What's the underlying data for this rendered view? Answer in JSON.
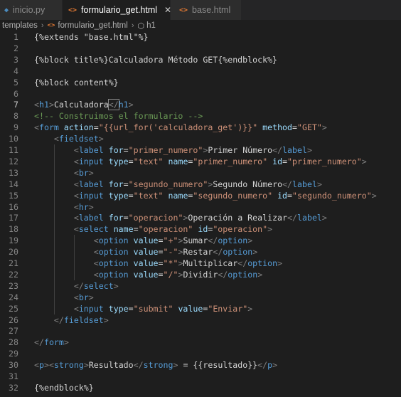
{
  "tabs": [
    {
      "icon": "python-file-icon",
      "glyph": "◆",
      "label": "inicio.py",
      "active": false,
      "color": "#4b8bbe"
    },
    {
      "icon": "html-file-icon",
      "glyph": "<>",
      "label": "formulario_get.html",
      "active": true,
      "color": "#e37933"
    },
    {
      "icon": "html-file-icon",
      "glyph": "<>",
      "label": "base.html",
      "active": false,
      "color": "#e37933"
    }
  ],
  "close_glyph": "✕",
  "breadcrumb": {
    "folder": "templates",
    "file": "formulario_get.html",
    "symbol": "h1"
  },
  "current_line": 7,
  "lines": [
    {
      "n": "1",
      "t": [
        [
          "tx",
          "{%extends \"base.html\"%}"
        ]
      ]
    },
    {
      "n": "2",
      "t": []
    },
    {
      "n": "3",
      "t": [
        [
          "tx",
          "{%block title%}Calculadora Método GET{%endblock%}"
        ]
      ]
    },
    {
      "n": "4",
      "t": []
    },
    {
      "n": "5",
      "t": [
        [
          "tx",
          "{%block content%}"
        ]
      ]
    },
    {
      "n": "6",
      "t": []
    },
    {
      "n": "7",
      "t": [
        [
          "t",
          "<"
        ],
        [
          "tag",
          "h1"
        ],
        [
          "t",
          ">"
        ],
        [
          "tx",
          "Calculadora"
        ],
        [
          "t",
          "</"
        ],
        [
          "tag",
          "h1"
        ],
        [
          "t",
          ">"
        ]
      ]
    },
    {
      "n": "8",
      "t": [
        [
          "cm",
          "<!-- Construimos el formulario -->"
        ]
      ]
    },
    {
      "n": "9",
      "t": [
        [
          "t",
          "<"
        ],
        [
          "tag",
          "form"
        ],
        [
          "tx",
          " "
        ],
        [
          "at",
          "action"
        ],
        [
          "tx",
          "="
        ],
        [
          "st",
          "\"{{url_for('calculadora_get')}}\""
        ],
        [
          "tx",
          " "
        ],
        [
          "at",
          "method"
        ],
        [
          "tx",
          "="
        ],
        [
          "st",
          "\"GET\""
        ],
        [
          "t",
          ">"
        ]
      ]
    },
    {
      "n": "10",
      "t": [
        [
          "tx",
          "    "
        ],
        [
          "t",
          "<"
        ],
        [
          "tag",
          "fieldset"
        ],
        [
          "t",
          ">"
        ]
      ]
    },
    {
      "n": "11",
      "t": [
        [
          "tx",
          "        "
        ],
        [
          "t",
          "<"
        ],
        [
          "tag",
          "label"
        ],
        [
          "tx",
          " "
        ],
        [
          "at",
          "for"
        ],
        [
          "tx",
          "="
        ],
        [
          "st",
          "\"primer_numero\""
        ],
        [
          "t",
          ">"
        ],
        [
          "tx",
          "Primer Número"
        ],
        [
          "t",
          "</"
        ],
        [
          "tag",
          "label"
        ],
        [
          "t",
          ">"
        ]
      ]
    },
    {
      "n": "12",
      "t": [
        [
          "tx",
          "        "
        ],
        [
          "t",
          "<"
        ],
        [
          "tag",
          "input"
        ],
        [
          "tx",
          " "
        ],
        [
          "at",
          "type"
        ],
        [
          "tx",
          "="
        ],
        [
          "st",
          "\"text\""
        ],
        [
          "tx",
          " "
        ],
        [
          "at",
          "name"
        ],
        [
          "tx",
          "="
        ],
        [
          "st",
          "\"primer_numero\""
        ],
        [
          "tx",
          " "
        ],
        [
          "at",
          "id"
        ],
        [
          "tx",
          "="
        ],
        [
          "st",
          "\"primer_numero\""
        ],
        [
          "t",
          ">"
        ]
      ]
    },
    {
      "n": "13",
      "t": [
        [
          "tx",
          "        "
        ],
        [
          "t",
          "<"
        ],
        [
          "tag",
          "br"
        ],
        [
          "t",
          ">"
        ]
      ]
    },
    {
      "n": "14",
      "t": [
        [
          "tx",
          "        "
        ],
        [
          "t",
          "<"
        ],
        [
          "tag",
          "label"
        ],
        [
          "tx",
          " "
        ],
        [
          "at",
          "for"
        ],
        [
          "tx",
          "="
        ],
        [
          "st",
          "\"segundo_numero\""
        ],
        [
          "t",
          ">"
        ],
        [
          "tx",
          "Segundo Número"
        ],
        [
          "t",
          "</"
        ],
        [
          "tag",
          "label"
        ],
        [
          "t",
          ">"
        ]
      ]
    },
    {
      "n": "15",
      "t": [
        [
          "tx",
          "        "
        ],
        [
          "t",
          "<"
        ],
        [
          "tag",
          "input"
        ],
        [
          "tx",
          " "
        ],
        [
          "at",
          "type"
        ],
        [
          "tx",
          "="
        ],
        [
          "st",
          "\"text\""
        ],
        [
          "tx",
          " "
        ],
        [
          "at",
          "name"
        ],
        [
          "tx",
          "="
        ],
        [
          "st",
          "\"segundo_numero\""
        ],
        [
          "tx",
          " "
        ],
        [
          "at",
          "id"
        ],
        [
          "tx",
          "="
        ],
        [
          "st",
          "\"segundo_numero\""
        ],
        [
          "t",
          ">"
        ]
      ]
    },
    {
      "n": "16",
      "t": [
        [
          "tx",
          "        "
        ],
        [
          "t",
          "<"
        ],
        [
          "tag",
          "hr"
        ],
        [
          "t",
          ">"
        ]
      ]
    },
    {
      "n": "17",
      "t": [
        [
          "tx",
          "        "
        ],
        [
          "t",
          "<"
        ],
        [
          "tag",
          "label"
        ],
        [
          "tx",
          " "
        ],
        [
          "at",
          "for"
        ],
        [
          "tx",
          "="
        ],
        [
          "st",
          "\"operacion\""
        ],
        [
          "t",
          ">"
        ],
        [
          "tx",
          "Operación a Realizar"
        ],
        [
          "t",
          "</"
        ],
        [
          "tag",
          "label"
        ],
        [
          "t",
          ">"
        ]
      ]
    },
    {
      "n": "18",
      "t": [
        [
          "tx",
          "        "
        ],
        [
          "t",
          "<"
        ],
        [
          "tag",
          "select"
        ],
        [
          "tx",
          " "
        ],
        [
          "at",
          "name"
        ],
        [
          "tx",
          "="
        ],
        [
          "st",
          "\"operacion\""
        ],
        [
          "tx",
          " "
        ],
        [
          "at",
          "id"
        ],
        [
          "tx",
          "="
        ],
        [
          "st",
          "\"operacion\""
        ],
        [
          "t",
          ">"
        ]
      ]
    },
    {
      "n": "19",
      "t": [
        [
          "tx",
          "            "
        ],
        [
          "t",
          "<"
        ],
        [
          "tag",
          "option"
        ],
        [
          "tx",
          " "
        ],
        [
          "at",
          "value"
        ],
        [
          "tx",
          "="
        ],
        [
          "st",
          "\"+\""
        ],
        [
          "t",
          ">"
        ],
        [
          "tx",
          "Sumar"
        ],
        [
          "t",
          "</"
        ],
        [
          "tag",
          "option"
        ],
        [
          "t",
          ">"
        ]
      ]
    },
    {
      "n": "20",
      "t": [
        [
          "tx",
          "            "
        ],
        [
          "t",
          "<"
        ],
        [
          "tag",
          "option"
        ],
        [
          "tx",
          " "
        ],
        [
          "at",
          "value"
        ],
        [
          "tx",
          "="
        ],
        [
          "st",
          "\"-\""
        ],
        [
          "t",
          ">"
        ],
        [
          "tx",
          "Restar"
        ],
        [
          "t",
          "</"
        ],
        [
          "tag",
          "option"
        ],
        [
          "t",
          ">"
        ]
      ]
    },
    {
      "n": "21",
      "t": [
        [
          "tx",
          "            "
        ],
        [
          "t",
          "<"
        ],
        [
          "tag",
          "option"
        ],
        [
          "tx",
          " "
        ],
        [
          "at",
          "value"
        ],
        [
          "tx",
          "="
        ],
        [
          "st",
          "\"*\""
        ],
        [
          "t",
          ">"
        ],
        [
          "tx",
          "Multiplicar"
        ],
        [
          "t",
          "</"
        ],
        [
          "tag",
          "option"
        ],
        [
          "t",
          ">"
        ]
      ]
    },
    {
      "n": "22",
      "t": [
        [
          "tx",
          "            "
        ],
        [
          "t",
          "<"
        ],
        [
          "tag",
          "option"
        ],
        [
          "tx",
          " "
        ],
        [
          "at",
          "value"
        ],
        [
          "tx",
          "="
        ],
        [
          "st",
          "\"/\""
        ],
        [
          "t",
          ">"
        ],
        [
          "tx",
          "Dividir"
        ],
        [
          "t",
          "</"
        ],
        [
          "tag",
          "option"
        ],
        [
          "t",
          ">"
        ]
      ]
    },
    {
      "n": "23",
      "t": [
        [
          "tx",
          "        "
        ],
        [
          "t",
          "</"
        ],
        [
          "tag",
          "select"
        ],
        [
          "t",
          ">"
        ]
      ]
    },
    {
      "n": "24",
      "t": [
        [
          "tx",
          "        "
        ],
        [
          "t",
          "<"
        ],
        [
          "tag",
          "br"
        ],
        [
          "t",
          ">"
        ]
      ]
    },
    {
      "n": "25",
      "t": [
        [
          "tx",
          "        "
        ],
        [
          "t",
          "<"
        ],
        [
          "tag",
          "input"
        ],
        [
          "tx",
          " "
        ],
        [
          "at",
          "type"
        ],
        [
          "tx",
          "="
        ],
        [
          "st",
          "\"submit\""
        ],
        [
          "tx",
          " "
        ],
        [
          "at",
          "value"
        ],
        [
          "tx",
          "="
        ],
        [
          "st",
          "\"Enviar\""
        ],
        [
          "t",
          ">"
        ]
      ]
    },
    {
      "n": "26",
      "t": [
        [
          "tx",
          "    "
        ],
        [
          "t",
          "</"
        ],
        [
          "tag",
          "fieldset"
        ],
        [
          "t",
          ">"
        ]
      ]
    },
    {
      "n": "27",
      "t": []
    },
    {
      "n": "28",
      "t": [
        [
          "t",
          "</"
        ],
        [
          "tag",
          "form"
        ],
        [
          "t",
          ">"
        ]
      ]
    },
    {
      "n": "29",
      "t": []
    },
    {
      "n": "30",
      "t": [
        [
          "t",
          "<"
        ],
        [
          "tag",
          "p"
        ],
        [
          "t",
          "><"
        ],
        [
          "tag",
          "strong"
        ],
        [
          "t",
          ">"
        ],
        [
          "tx",
          "Resultado"
        ],
        [
          "t",
          "</"
        ],
        [
          "tag",
          "strong"
        ],
        [
          "t",
          ">"
        ],
        [
          "tx",
          " = {{resultado}}"
        ],
        [
          "t",
          "</"
        ],
        [
          "tag",
          "p"
        ],
        [
          "t",
          ">"
        ]
      ]
    },
    {
      "n": "31",
      "t": []
    },
    {
      "n": "32",
      "t": [
        [
          "tx",
          "{%endblock%}"
        ]
      ]
    }
  ]
}
